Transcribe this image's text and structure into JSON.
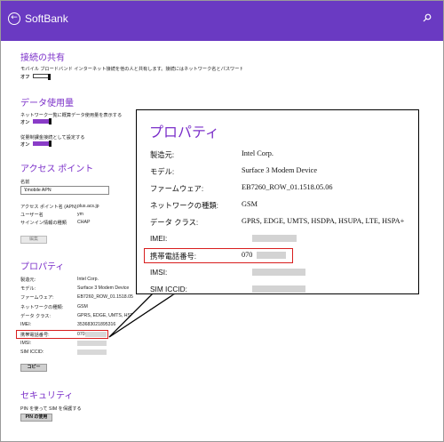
{
  "titlebar": {
    "app_title": "SoftBank"
  },
  "sections": {
    "connection_sharing": {
      "title": "接続の共有",
      "description": "モバイル ブロードバンド インターネット接続を他の人と共有します。接続にはネットワーク名とパスワードが必要になります。",
      "toggle_state": "オフ"
    },
    "data_usage": {
      "title": "データ使用量",
      "option1": "ネットワーク一覧に概算データ使用量を表示する",
      "option1_state": "オン",
      "option2": "従量制課金接続として設定する",
      "option2_state": "オン"
    },
    "access_point": {
      "title": "アクセス ポイント",
      "name_label": "名前",
      "selected_apn": "Ymobile APN",
      "rows": [
        {
          "label": "アクセス ポイント名 (APN)",
          "value": "plus.acs.jp"
        },
        {
          "label": "ユーザー名",
          "value": "ym"
        },
        {
          "label": "サインイン情報の種類",
          "value": "CHAP"
        }
      ],
      "edit_button": "編集"
    },
    "properties": {
      "title": "プロパティ",
      "rows": [
        {
          "label": "製造元:",
          "value": "Intel Corp."
        },
        {
          "label": "モデル:",
          "value": "Surface 3 Modem Device"
        },
        {
          "label": "ファームウェア:",
          "value": "EB7260_ROW_01.1518.05"
        },
        {
          "label": "ネットワークの種類:",
          "value": "GSM"
        },
        {
          "label": "データ クラス:",
          "value": "GPRS, EDGE, UMTS, HSDP"
        },
        {
          "label": "IMEI:",
          "value": "353683021895316"
        },
        {
          "label": "携帯電話番号:",
          "value": "070"
        },
        {
          "label": "IMSI:",
          "value": ""
        },
        {
          "label": "SIM ICCID:",
          "value": ""
        }
      ],
      "copy_button": "コピー"
    },
    "security": {
      "title": "セキュリティ",
      "description": "PIN を使って SIM を保護する",
      "pin_button": "PIN の使用"
    }
  },
  "callout": {
    "title": "プロパティ",
    "rows": [
      {
        "label": "製造元:",
        "value": "Intel Corp."
      },
      {
        "label": "モデル:",
        "value": "Surface 3 Modem Device"
      },
      {
        "label": "ファームウェア:",
        "value": "EB7260_ROW_01.1518.05.06"
      },
      {
        "label": "ネットワークの種類:",
        "value": "GSM"
      },
      {
        "label": "データ クラス:",
        "value": "GPRS, EDGE, UMTS, HSDPA, HSUPA, LTE, HSPA+"
      },
      {
        "label": "IMEI:",
        "value": ""
      },
      {
        "label": "携帯電話番号:",
        "value": "070"
      },
      {
        "label": "IMSI:",
        "value": ""
      },
      {
        "label": "SIM ICCID:",
        "value": ""
      }
    ]
  },
  "colors": {
    "titlebar": "#6a3ac2",
    "accent": "#7b2fc9",
    "highlight": "#d81e1e"
  },
  "icons": {
    "back": "back-arrow-icon",
    "search": "search-icon"
  }
}
